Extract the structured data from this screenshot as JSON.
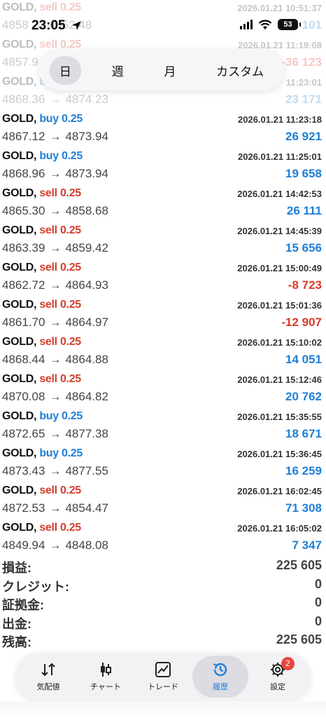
{
  "status_bar": {
    "time": "23:05",
    "battery": "53"
  },
  "period_tabs": [
    {
      "label": "日",
      "active": true
    },
    {
      "label": "週",
      "active": false
    },
    {
      "label": "月",
      "active": false
    },
    {
      "label": "カスタム",
      "active": false
    }
  ],
  "trades": [
    {
      "symbol": "GOLD,",
      "side": "sell",
      "size": "sell 0.25",
      "open": "4858",
      "close": "4852.48",
      "date": "2026.01.21 10:51:37",
      "profit": "32 101",
      "profit_positive": true
    },
    {
      "symbol": "GOLD,",
      "side": "sell",
      "size": "sell 0.25",
      "open": "4857.9",
      "close": "",
      "date": "2026.01.21 11:19:08",
      "profit": "-36 123",
      "profit_positive": false
    },
    {
      "symbol": "GOLD,",
      "side": "buy",
      "size": "bu",
      "open": "4868.36",
      "close": "4874.23",
      "date": "11:23:01",
      "profit": "23 171",
      "profit_positive": true
    },
    {
      "symbol": "GOLD,",
      "side": "buy",
      "size": "buy 0.25",
      "open": "4867.12",
      "close": "4873.94",
      "date": "2026.01.21 11:23:18",
      "profit": "26 921",
      "profit_positive": true
    },
    {
      "symbol": "GOLD,",
      "side": "buy",
      "size": "buy 0.25",
      "open": "4868.96",
      "close": "4873.94",
      "date": "2026.01.21 11:25:01",
      "profit": "19 658",
      "profit_positive": true
    },
    {
      "symbol": "GOLD,",
      "side": "sell",
      "size": "sell 0.25",
      "open": "4865.30",
      "close": "4858.68",
      "date": "2026.01.21 14:42:53",
      "profit": "26 111",
      "profit_positive": true
    },
    {
      "symbol": "GOLD,",
      "side": "sell",
      "size": "sell 0.25",
      "open": "4863.39",
      "close": "4859.42",
      "date": "2026.01.21 14:45:39",
      "profit": "15 656",
      "profit_positive": true
    },
    {
      "symbol": "GOLD,",
      "side": "sell",
      "size": "sell 0.25",
      "open": "4862.72",
      "close": "4864.93",
      "date": "2026.01.21 15:00:49",
      "profit": "-8 723",
      "profit_positive": false
    },
    {
      "symbol": "GOLD,",
      "side": "sell",
      "size": "sell 0.25",
      "open": "4861.70",
      "close": "4864.97",
      "date": "2026.01.21 15:01:36",
      "profit": "-12 907",
      "profit_positive": false
    },
    {
      "symbol": "GOLD,",
      "side": "sell",
      "size": "sell 0.25",
      "open": "4868.44",
      "close": "4864.88",
      "date": "2026.01.21 15:10:02",
      "profit": "14 051",
      "profit_positive": true
    },
    {
      "symbol": "GOLD,",
      "side": "sell",
      "size": "sell 0.25",
      "open": "4870.08",
      "close": "4864.82",
      "date": "2026.01.21 15:12:46",
      "profit": "20 762",
      "profit_positive": true
    },
    {
      "symbol": "GOLD,",
      "side": "buy",
      "size": "buy 0.25",
      "open": "4872.65",
      "close": "4877.38",
      "date": "2026.01.21 15:35:55",
      "profit": "18 671",
      "profit_positive": true
    },
    {
      "symbol": "GOLD,",
      "side": "buy",
      "size": "buy 0.25",
      "open": "4873.43",
      "close": "4877.55",
      "date": "2026.01.21 15:36:45",
      "profit": "16 259",
      "profit_positive": true
    },
    {
      "symbol": "GOLD,",
      "side": "sell",
      "size": "sell 0.25",
      "open": "4872.53",
      "close": "4854.47",
      "date": "2026.01.21 16:02:45",
      "profit": "71 308",
      "profit_positive": true
    },
    {
      "symbol": "GOLD,",
      "side": "sell",
      "size": "sell 0.25",
      "open": "4849.94",
      "close": "4848.08",
      "date": "2026.01.21 16:05:02",
      "profit": "7 347",
      "profit_positive": true
    }
  ],
  "arrow": "→",
  "summary": [
    {
      "label": "損益:",
      "value": "225 605"
    },
    {
      "label": "クレジット:",
      "value": "0"
    },
    {
      "label": "証拠金:",
      "value": "0"
    },
    {
      "label": "出金:",
      "value": "0"
    },
    {
      "label": "残高:",
      "value": "225 605"
    }
  ],
  "bottom_nav": [
    {
      "label": "気配値",
      "icon": "quotes-arrows-icon",
      "active": false
    },
    {
      "label": "チャート",
      "icon": "candlestick-chart-icon",
      "active": false
    },
    {
      "label": "トレード",
      "icon": "trade-line-chart-icon",
      "active": false
    },
    {
      "label": "履歴",
      "icon": "history-clock-icon",
      "active": true
    },
    {
      "label": "設定",
      "icon": "gear-icon",
      "active": false,
      "badge": "2"
    }
  ],
  "colors": {
    "sell": "#d2402f",
    "buy": "#1f7fd6",
    "positive": "#1f7fd6",
    "negative": "#d83a2a"
  }
}
